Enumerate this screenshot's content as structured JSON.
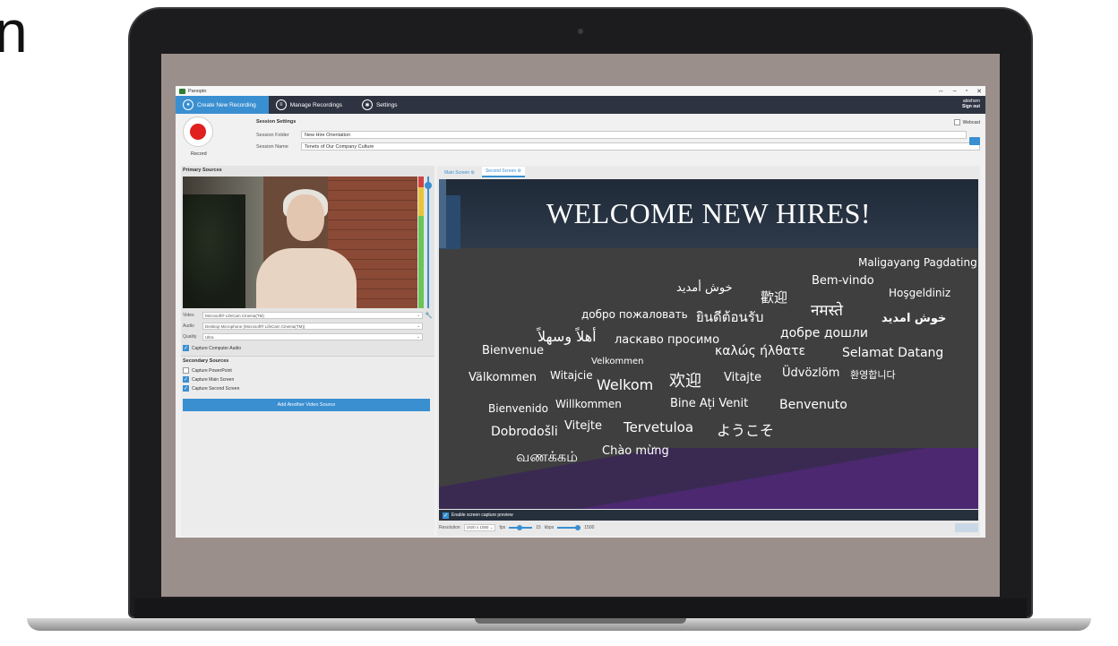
{
  "corner_glyph": "n",
  "app": {
    "title": "Panopto",
    "window_controls": [
      "↔",
      "–",
      "▫",
      "✕"
    ]
  },
  "nav": {
    "tabs": [
      {
        "label": "Create New Recording",
        "icon": "camera-icon"
      },
      {
        "label": "Manage Recordings",
        "icon": "list-icon"
      },
      {
        "label": "Settings",
        "icon": "gear-icon"
      }
    ],
    "user": "abishorn",
    "sign_out": "Sign out"
  },
  "session": {
    "record_label": "Record",
    "title": "Session Settings",
    "folder_label": "Session Folder",
    "folder_value": "New Hire Orientation",
    "name_label": "Session Name",
    "name_value": "Tenets of Our Company Culture",
    "webcast_label": "Webcast"
  },
  "primary": {
    "title": "Primary Sources",
    "video_label": "Video",
    "video_value": "Microsoft® LifeCam Cinema(TM)",
    "audio_label": "Audio",
    "audio_value": "Desktop Microphone (Microsoft® LifeCam Cinema(TM))",
    "quality_label": "Quality",
    "quality_value": "Ultra",
    "capture_audio": "Capture Computer Audio"
  },
  "secondary": {
    "title": "Secondary Sources",
    "items": [
      {
        "label": "Capture PowerPoint",
        "checked": false
      },
      {
        "label": "Capture Main Screen",
        "checked": true
      },
      {
        "label": "Capture Second Screen",
        "checked": true
      }
    ],
    "add_button": "Add Another Video Source"
  },
  "screens": {
    "tabs": [
      "Main Screen",
      "Second Screen"
    ],
    "active_tab": "Second Screen",
    "enable_preview": "Enable screen capture preview",
    "resolution_label": "Resolution",
    "resolution_value": "1920 x 1080",
    "fps_label": "fps",
    "fps_value": "15",
    "kbps_label": "kbps",
    "kbps_value": "1500",
    "apply_label": "Apply"
  },
  "slide": {
    "title": "WELCOME NEW HIRES!",
    "words": [
      "Maligayang Pagdating",
      "Bem-vindo",
      "خوش أمديد",
      "歡迎",
      "Hoşgeldiniz",
      "добро пожаловать",
      "ยินดีต้อนรับ",
      "नमस्ते",
      "خوش امديد",
      "أهلاً وسهلاً",
      "ласкаво просимо",
      "добре дошли",
      "Bienvenue",
      "καλώς ήλθατε",
      "Selamat Datang",
      "Velkommen",
      "Välkommen",
      "Witajcie",
      "Welkom",
      "欢迎",
      "Vitajte",
      "Üdvözlöm",
      "환영합니다",
      "Bienvenido",
      "Willkommen",
      "Bine Ați Venit",
      "Benvenuto",
      "Dobrodošli",
      "Vitejte",
      "Tervetuloa",
      "ようこそ",
      "வணக்கம்",
      "Chào mừng"
    ]
  },
  "colors": {
    "accent": "#3a8fd1",
    "nav_bg": "#2d3340",
    "record": "#e01f1f"
  }
}
